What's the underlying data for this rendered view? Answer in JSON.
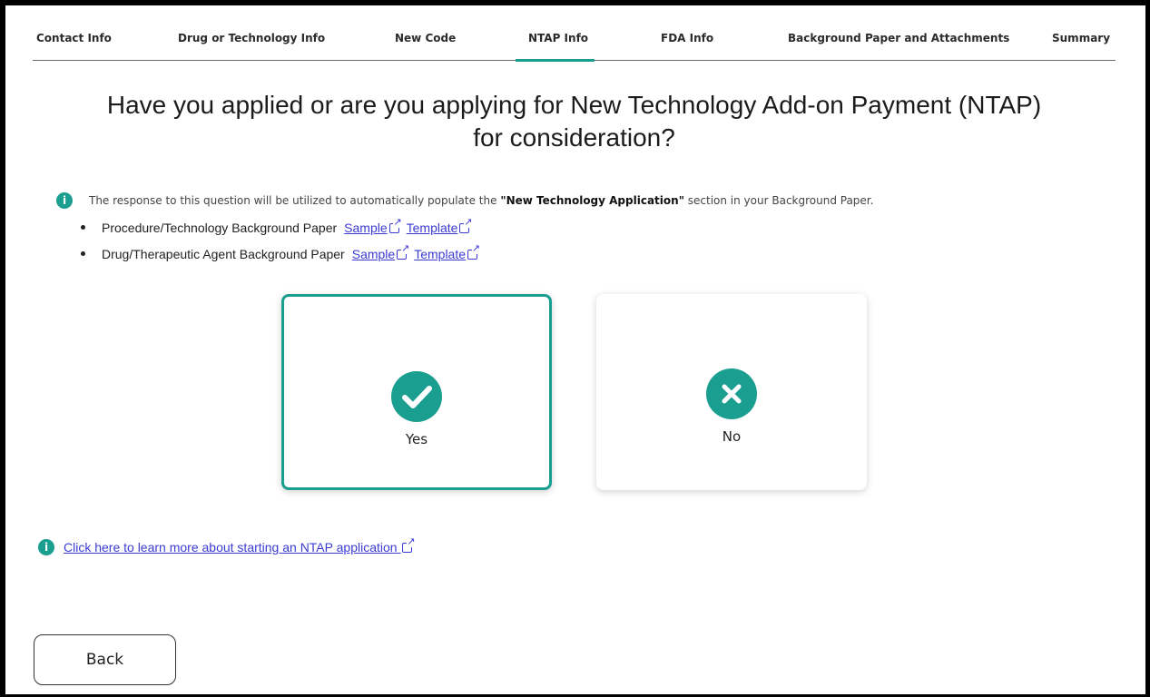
{
  "tabs": [
    {
      "label": "Contact Info"
    },
    {
      "label": "Drug or Technology Info"
    },
    {
      "label": "New Code"
    },
    {
      "label": "NTAP Info",
      "active": true
    },
    {
      "label": "FDA Info"
    },
    {
      "label": "Background Paper and Attachments"
    },
    {
      "label": "Summary"
    }
  ],
  "heading": {
    "line1": "Have you applied or are you applying for New Technology Add-on Payment (NTAP)",
    "line2": "for consideration?"
  },
  "info": {
    "text_before": "The response to this question will be utilized to automatically populate the ",
    "bold": "\"New Technology Application\"",
    "text_after": " section in your Background Paper."
  },
  "bullets": [
    {
      "label": "Procedure/Technology Background Paper",
      "sample": "Sample",
      "template": "Template"
    },
    {
      "label": "Drug/Therapeutic Agent Background Paper",
      "sample": "Sample",
      "template": "Template"
    }
  ],
  "options": {
    "yes": {
      "label": "Yes",
      "selected": true
    },
    "no": {
      "label": "No",
      "selected": false
    }
  },
  "learn_more": "Click here to learn more about starting an NTAP application",
  "back_label": "Back",
  "colors": {
    "accent": "#1a9e90",
    "link": "#3b3bd4"
  }
}
